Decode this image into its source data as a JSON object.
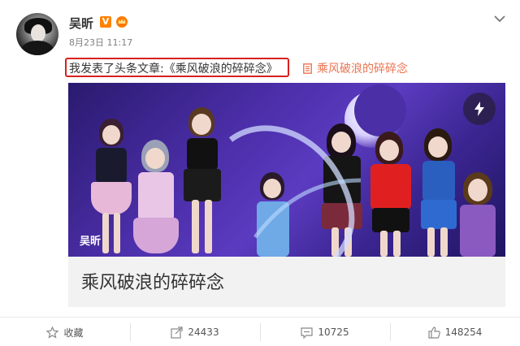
{
  "post": {
    "username": "吴昕",
    "badge": "V",
    "timestamp": "8月23日 11:17",
    "text": "我发表了头条文章:《乘风破浪的碎碎念》",
    "article_link": "乘风破浪的碎碎念"
  },
  "card": {
    "image_caption": "吴昕",
    "title": "乘风破浪的碎碎念"
  },
  "actions": {
    "favorite": "收藏",
    "repost_count": "24433",
    "comment_count": "10725",
    "like_count": "148254"
  },
  "colors": {
    "highlight_border": "#d82020",
    "link": "#eb7350",
    "badge": "#ff8200"
  }
}
